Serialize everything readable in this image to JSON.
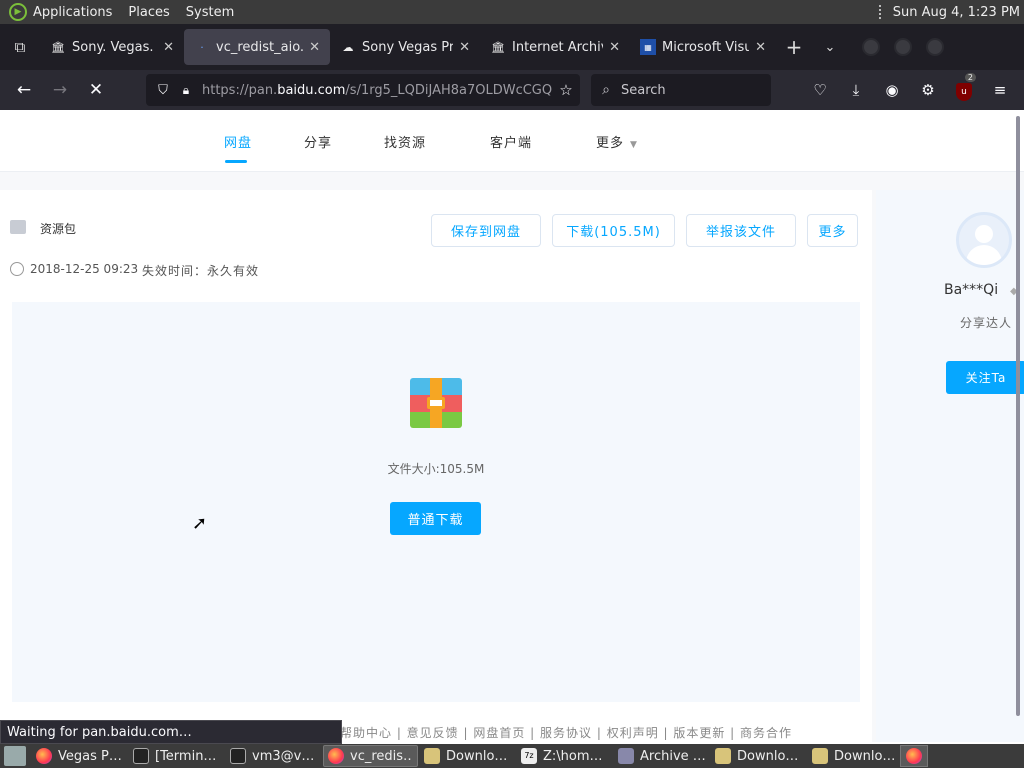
{
  "top_panel": {
    "menus": [
      "Applications",
      "Places",
      "System"
    ],
    "clock": "Sun Aug  4,  1:23 PM"
  },
  "tabs": [
    {
      "title": "Sony. Vegas. Pro",
      "icon": "archive-icon",
      "active": false
    },
    {
      "title": "vc_redist_aio.zip",
      "icon": "loading-icon",
      "active": true
    },
    {
      "title": "Sony Vegas Pro",
      "icon": "cloud-icon",
      "active": false
    },
    {
      "title": "Internet Archive",
      "icon": "archive-icon",
      "active": false
    },
    {
      "title": "Microsoft Visual",
      "icon": "ms-icon",
      "active": false
    }
  ],
  "navbar": {
    "url_prefix": "https://pan.",
    "url_domain": "baidu.com",
    "url_suffix": "/s/1rg5_LQDiJAH8a7OLDWcCGQ",
    "search_placeholder": "Search",
    "ublock_count": "2"
  },
  "site_nav": {
    "items": [
      "网盘",
      "分享",
      "找资源",
      "客户端",
      "更多"
    ]
  },
  "file": {
    "name": "资源包",
    "date": "2018-12-25 09:23",
    "expire": "失效时间：永久有效"
  },
  "actions": {
    "save": "保存到网盘",
    "download": "下载(105.5M)",
    "report": "举报该文件",
    "more": "更多"
  },
  "preview": {
    "size_text": "文件大小:105.5M",
    "download_btn": "普通下载"
  },
  "user": {
    "name": "Ba***Qi",
    "sub": "分享达人",
    "follow": "关注Ta"
  },
  "footer": "帮助中心 | 意见反馈 | 网盘首页 | 服务协议 | 权利声明 | 版本更新 | 商务合作",
  "status_tip": "Waiting for pan.baidu.com…",
  "taskbar": [
    {
      "label": "Vegas P…",
      "icon": "firefox-icon",
      "active": false
    },
    {
      "label": "[Termin…",
      "icon": "terminal-icon",
      "active": false
    },
    {
      "label": "vm3@v…",
      "icon": "terminal-icon",
      "active": false
    },
    {
      "label": "vc_redis…",
      "icon": "firefox-icon",
      "active": true
    },
    {
      "label": "Downlo…",
      "icon": "folder-icon",
      "active": false
    },
    {
      "label": "Z:\\hom…",
      "icon": "7zip-icon",
      "active": false
    },
    {
      "label": "Archive …",
      "icon": "archive-manager-icon",
      "active": false
    },
    {
      "label": "Downlo…",
      "icon": "folder-icon",
      "active": false
    },
    {
      "label": "Downlo…",
      "icon": "folder-icon",
      "active": false
    }
  ],
  "colors": {
    "accent": "#06a7ff",
    "panel": "#3b3b3b",
    "browser_chrome": "#2b2a33"
  }
}
